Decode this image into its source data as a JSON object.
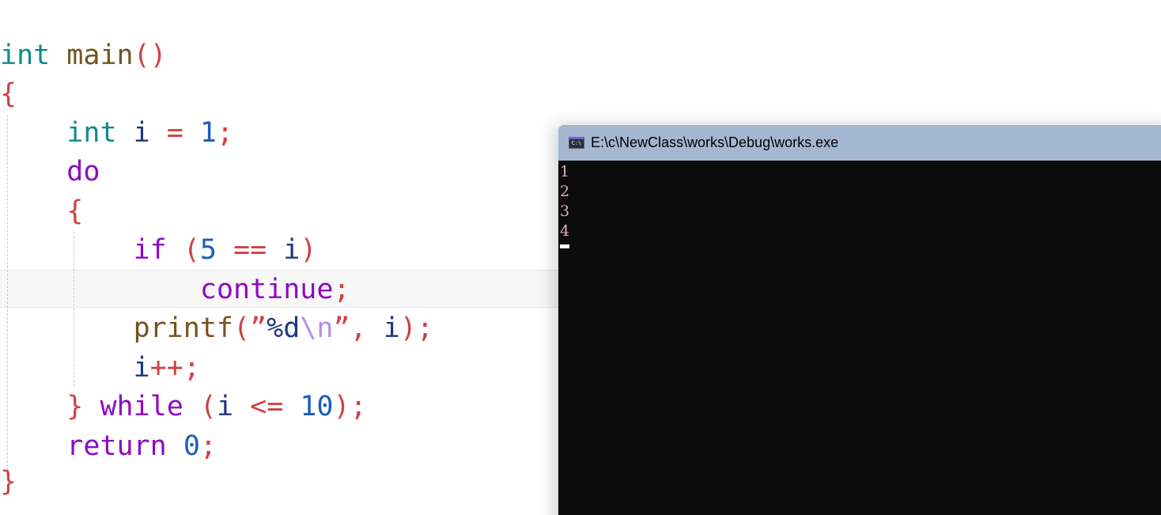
{
  "editor": {
    "line1": {
      "type": "int",
      "name": "main",
      "parens": "()"
    },
    "line2": {
      "brace": "{"
    },
    "line3": {
      "type": "int",
      "var": "i",
      "eq": "=",
      "num": "1",
      "semi": ";"
    },
    "line4": {
      "kw": "do"
    },
    "line5": {
      "brace": "{"
    },
    "line6": {
      "kw": "if",
      "open": "(",
      "num": "5",
      "op": "==",
      "var": "i",
      "close": ")"
    },
    "line7": {
      "kw": "continue",
      "semi": ";"
    },
    "line8": {
      "fn": "printf",
      "open": "(",
      "q1": "”",
      "fmt": "%d",
      "esc": "\\n",
      "q2": "”",
      "comma": ",",
      "var": "i",
      "close": ")",
      "semi": ";"
    },
    "line9": {
      "var": "i",
      "op": "++",
      "semi": ";"
    },
    "line10": {
      "brace": "}",
      "kw": "while",
      "open": "(",
      "var": "i",
      "op": "<=",
      "num": "10",
      "close": ")",
      "semi": ";"
    },
    "line11": {
      "kw": "return",
      "num": "0",
      "semi": ";"
    },
    "line12": {
      "brace": "}"
    }
  },
  "console": {
    "title": "E:\\c\\NewClass\\works\\Debug\\works.exe",
    "icon_label": "C:\\",
    "output": [
      "1",
      "2",
      "3",
      "4"
    ]
  },
  "colors": {
    "type_keyword": "#0e8a8e",
    "control_keyword": "#8f08c4",
    "function": "#74531f",
    "punctuation": "#d04045",
    "variable": "#1f377f",
    "number": "#1c5bbf",
    "console_bg": "#0c0c0c",
    "titlebar_bg": "#a3b7d0"
  }
}
